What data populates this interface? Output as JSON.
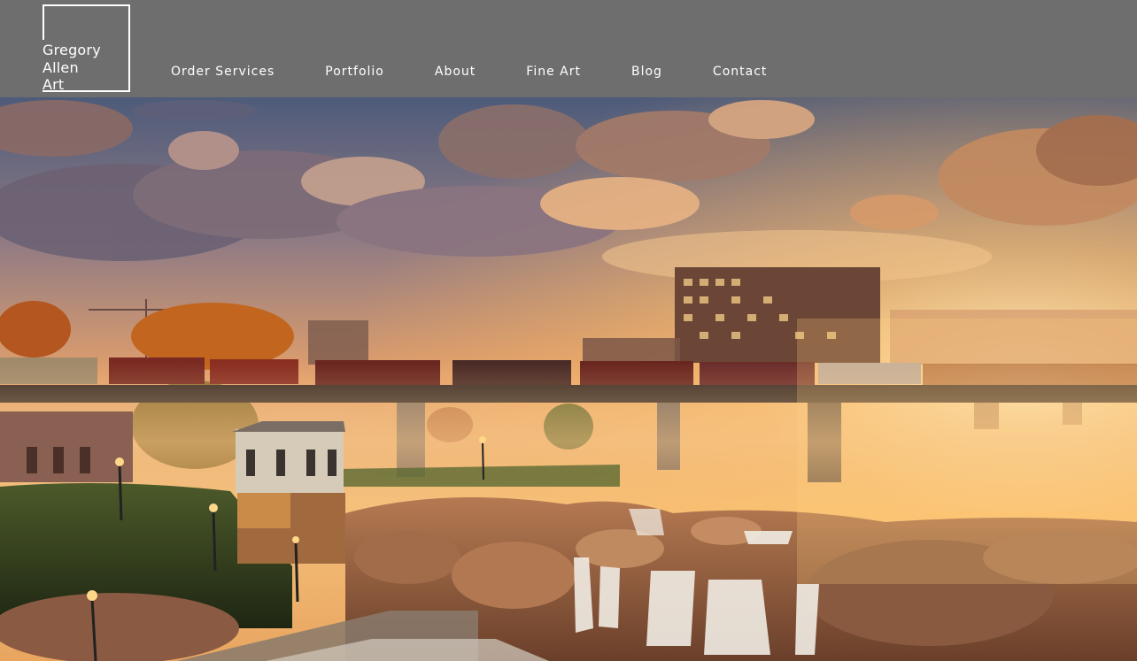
{
  "logo": {
    "lines": [
      "Gregory",
      "Allen",
      "Art"
    ]
  },
  "nav": {
    "items": [
      {
        "label": "Order Services"
      },
      {
        "label": "Portfolio"
      },
      {
        "label": "About"
      },
      {
        "label": "Fine Art"
      },
      {
        "label": "Blog"
      },
      {
        "label": "Contact"
      }
    ]
  },
  "colors": {
    "header_bg": "#6e6e6e",
    "text": "#ffffff",
    "sky_top": "#4a5a78",
    "sunset_glow": "#f4b25e"
  }
}
